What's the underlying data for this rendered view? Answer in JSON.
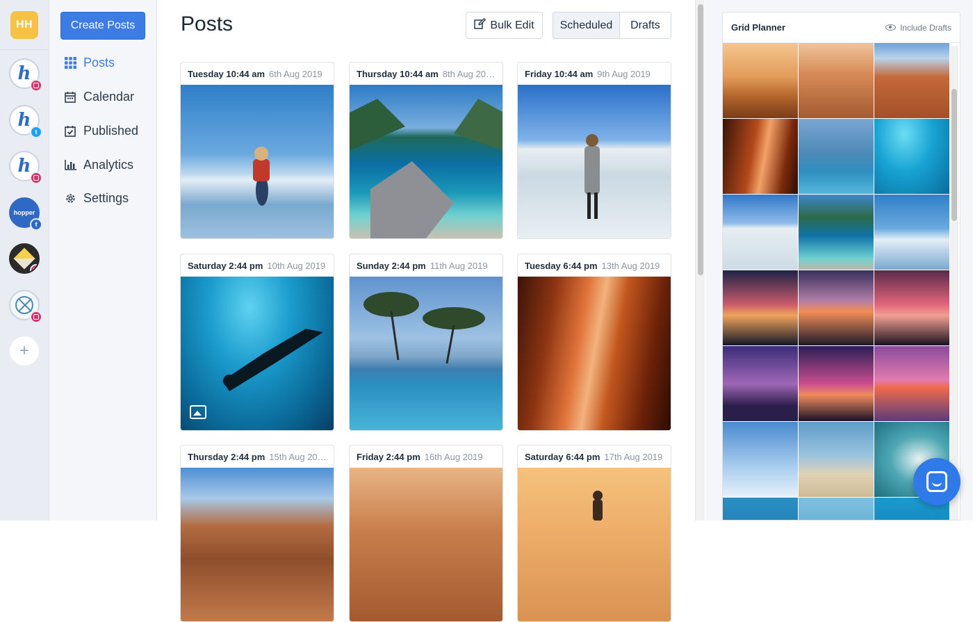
{
  "user": {
    "initials": "HH"
  },
  "accounts": [
    {
      "name": "hopper-instagram",
      "network": "instagram"
    },
    {
      "name": "hopper-twitter",
      "network": "twitter"
    },
    {
      "name": "hopper-instagram-2",
      "network": "instagram"
    },
    {
      "name": "hopper-facebook",
      "network": "facebook",
      "logo_text": "hopper"
    },
    {
      "name": "cube-instagram",
      "network": "instagram"
    },
    {
      "name": "compass-instagram",
      "network": "instagram"
    }
  ],
  "add_account_label": "+",
  "nav": {
    "create_button": "Create Posts",
    "items": [
      {
        "label": "Posts",
        "icon": "grid-icon",
        "active": true
      },
      {
        "label": "Calendar",
        "icon": "calendar-icon",
        "active": false
      },
      {
        "label": "Published",
        "icon": "check-calendar-icon",
        "active": false
      },
      {
        "label": "Analytics",
        "icon": "bar-chart-icon",
        "active": false
      },
      {
        "label": "Settings",
        "icon": "gear-icon",
        "active": false
      }
    ]
  },
  "main": {
    "title": "Posts",
    "bulk_edit_label": "Bulk Edit",
    "tabs": {
      "scheduled": "Scheduled",
      "drafts": "Drafts",
      "active": "Scheduled"
    },
    "posts": [
      {
        "time": "Tuesday 10:44 am",
        "date": "6th Aug 2019",
        "image": "child-on-beach"
      },
      {
        "time": "Thursday 10:44 am",
        "date": "8th Aug 20…",
        "image": "lagoon-cliffs"
      },
      {
        "time": "Friday 10:44 am",
        "date": "9th Aug 2019",
        "image": "woman-salt-flat"
      },
      {
        "time": "Saturday 2:44 pm",
        "date": "10th Aug 2019",
        "image": "scuba-diver",
        "multi": true
      },
      {
        "time": "Sunday 2:44 pm",
        "date": "11th Aug 2019",
        "image": "infinity-pool"
      },
      {
        "time": "Tuesday 6:44 pm",
        "date": "13th Aug 2019",
        "image": "antelope-canyon"
      },
      {
        "time": "Thursday 2:44 pm",
        "date": "15th Aug 20…",
        "image": "red-rock-desert"
      },
      {
        "time": "Friday 2:44 pm",
        "date": "16th Aug 2019",
        "image": "petra-treasury"
      },
      {
        "time": "Saturday 6:44 pm",
        "date": "17th Aug 2019",
        "image": "sunset-person"
      }
    ]
  },
  "planner": {
    "title": "Grid Planner",
    "include_drafts_label": "Include Drafts",
    "tiles": [
      "desert-sunset-people",
      "petra-treasury",
      "red-rock-hiker",
      "antelope-canyon",
      "infinity-pool",
      "scuba-diver",
      "woman-salt-flat",
      "lagoon-cliffs",
      "child-on-beach",
      "sunset-trees",
      "sunset-rocks",
      "sunset-palms",
      "city-skyline-dusk",
      "sunset-tree",
      "pink-sunset-sea",
      "palm-trees-sky",
      "beach-chairs",
      "waves-from-above",
      "ocean-blue-1",
      "ocean-blue-2",
      "ocean-blue-3"
    ]
  },
  "colors": {
    "accent": "#3d7be5",
    "instagram": "#d6336c",
    "twitter": "#1da1f2",
    "facebook": "#2f69c4"
  }
}
